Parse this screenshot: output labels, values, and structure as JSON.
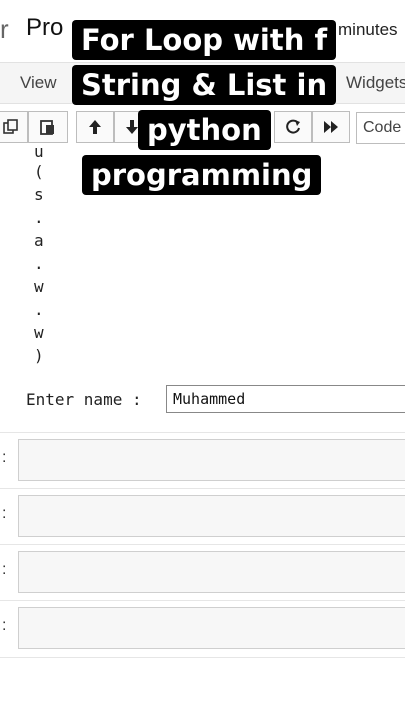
{
  "header": {
    "logo_fragment": "r",
    "notebook_title": "Pro",
    "saved_status": "minutes"
  },
  "menu": {
    "items": [
      "View",
      "Widgets"
    ]
  },
  "toolbar": {
    "buttons": [
      "copy-icon",
      "paste-icon",
      "arrow-up-icon",
      "arrow-down-icon",
      "restart-icon",
      "fast-forward-icon"
    ],
    "cell_type": "Code"
  },
  "output": {
    "chars": [
      "(",
      "s",
      ".",
      "a",
      ".",
      "w",
      ".",
      "w",
      ")"
    ],
    "prompt_label": "Enter name :",
    "input_value": "Muhammed"
  },
  "cells": [
    {
      "prompt": ":"
    },
    {
      "prompt": ":"
    },
    {
      "prompt": ":"
    },
    {
      "prompt": ":"
    }
  ],
  "overlay": {
    "lines": [
      "For Loop with f",
      "String & List in",
      "python",
      "programming"
    ]
  }
}
